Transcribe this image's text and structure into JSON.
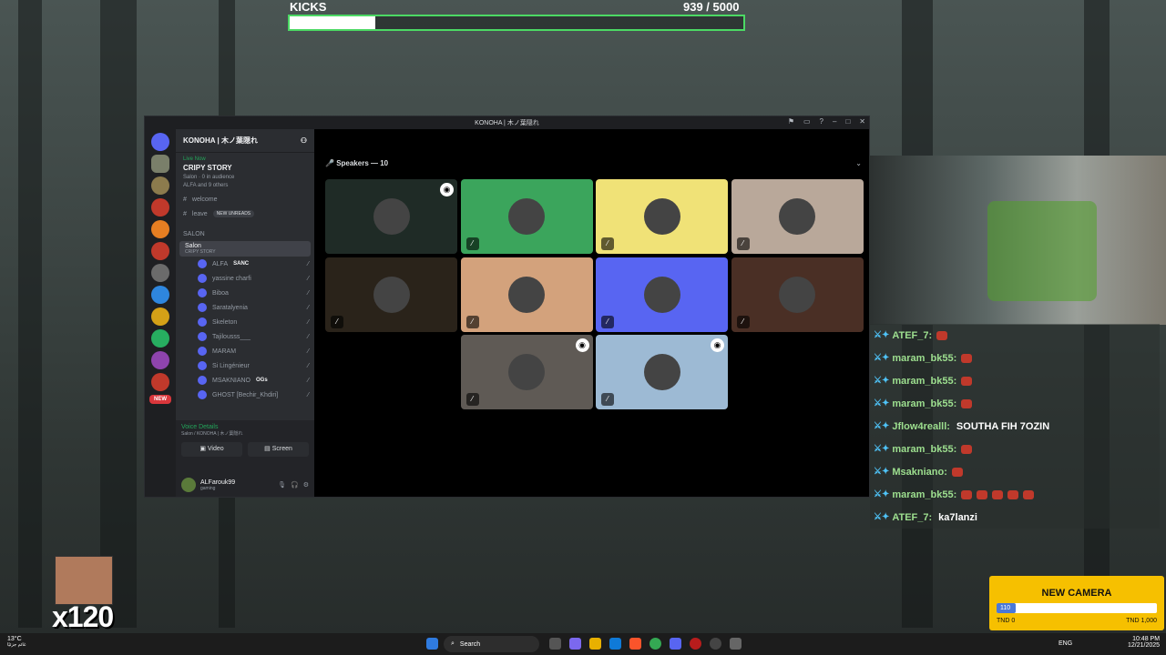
{
  "kicks": {
    "label": "KICKS",
    "count": "939 / 5000",
    "progress": 0.188
  },
  "window": {
    "title": "KONOHA | 木ノ葉隠れ"
  },
  "server": {
    "name": "KONOHA | 木ノ葉隠れ",
    "live_label": "Live Now",
    "stage_title": "CRIPY STORY",
    "stage_meta": "Salon · 0 in audience",
    "stage_people": "ALFA and 9 others",
    "channel_welcome": "welcome",
    "channel_leave": "leave",
    "new_unreads": "NEW UNREADS",
    "category": "SALON",
    "voice_channel": "Salon",
    "voice_sub": "CRIPY STORY",
    "members": [
      {
        "name": "ALFA",
        "tag": "SANC"
      },
      {
        "name": "yassine charfi",
        "tag": ""
      },
      {
        "name": "Biboa",
        "tag": ""
      },
      {
        "name": "Saratalyenia",
        "tag": ""
      },
      {
        "name": "Skeleton",
        "tag": ""
      },
      {
        "name": "Tajilousss___",
        "tag": ""
      },
      {
        "name": "MARAM",
        "tag": ""
      },
      {
        "name": "Si Lingénieur",
        "tag": ""
      },
      {
        "name": "MSAKNIANO",
        "tag": "OGs"
      },
      {
        "name": "GHOST [Bechir_Khdiri]",
        "tag": ""
      }
    ],
    "new_badge": "NEW",
    "voice_details": "Voice Details",
    "voice_details_sub": "Salon / KONOHA | 木ノ葉隠れ",
    "video_label": "Video",
    "screen_label": "Screen",
    "user_name": "ALFarouk99",
    "user_status": "gaming"
  },
  "stage": {
    "speakers_label": "Speakers — 10",
    "tiles": [
      {
        "color": "#1f2b26",
        "badge": true
      },
      {
        "color": "#3ba55c",
        "badge": false
      },
      {
        "color": "#f0e277",
        "badge": false
      },
      {
        "color": "#b9a89a",
        "badge": false
      },
      {
        "color": "#2a231a",
        "badge": false
      },
      {
        "color": "#d3a27c",
        "badge": false
      },
      {
        "color": "#5865f2",
        "badge": false
      },
      {
        "color": "#4a2f25",
        "badge": false
      },
      {
        "color": "#5f5a55",
        "badge": true
      },
      {
        "color": "#9dbad4",
        "badge": true
      }
    ]
  },
  "chat": [
    {
      "user": "ATEF_7:",
      "text": "",
      "emotes": 1
    },
    {
      "user": "maram_bk55:",
      "text": "",
      "emotes": 1
    },
    {
      "user": "maram_bk55:",
      "text": "",
      "emotes": 1
    },
    {
      "user": "maram_bk55:",
      "text": "",
      "emotes": 1
    },
    {
      "user": "Jflow4realll:",
      "text": "SOUTHA FIH 7OZIN",
      "emotes": 0
    },
    {
      "user": "maram_bk55:",
      "text": "",
      "emotes": 1
    },
    {
      "user": "Msakniano:",
      "text": "",
      "emotes": 1
    },
    {
      "user": "maram_bk55:",
      "text": "",
      "emotes": 5
    },
    {
      "user": "ATEF_7:",
      "text": "ka7lanzi",
      "emotes": 0
    }
  ],
  "goal": {
    "title": "NEW CAMERA",
    "current": "110",
    "start": "TND 0",
    "end": "TND 1,000",
    "progress": 0.11
  },
  "combo": {
    "text": "x120"
  },
  "taskbar": {
    "weather": "13°C",
    "weather_sub": "غائم جزئيًا",
    "search": "Search",
    "lang": "ENG",
    "time": "10:48 PM",
    "date": "12/21/2025"
  },
  "colors": {
    "accent": "#4cd964",
    "discord": "#5865f2",
    "goal": "#f6c000"
  }
}
